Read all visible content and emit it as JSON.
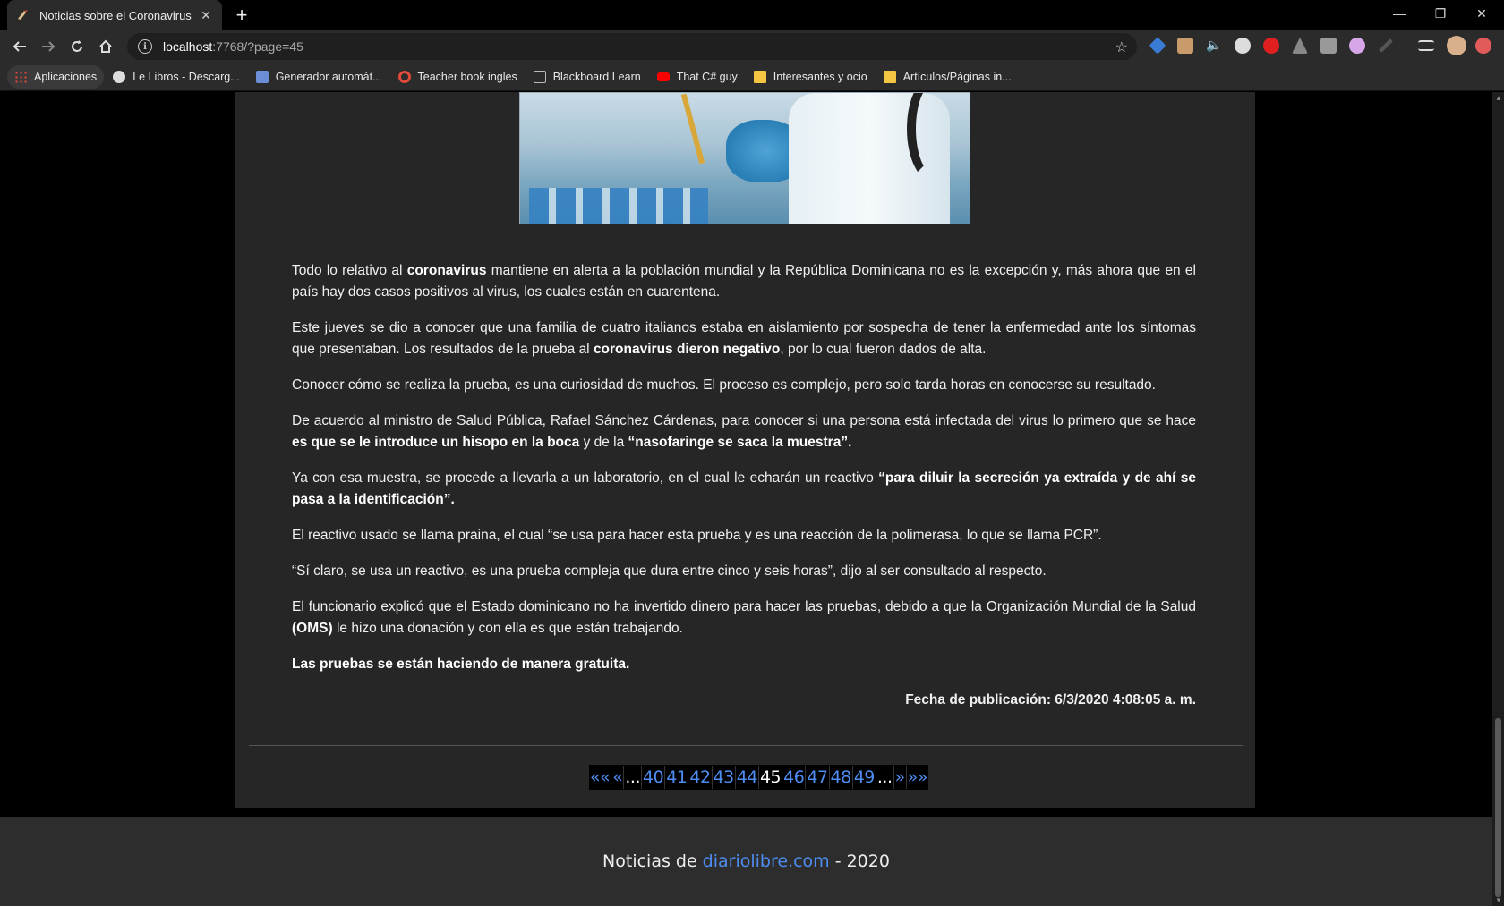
{
  "tab": {
    "title": "Noticias sobre el Coronavirus"
  },
  "address": {
    "host": "localhost",
    "rest": ":7768/?page=45"
  },
  "bookmarks": [
    {
      "label": "Aplicaciones",
      "color": "#e8453c"
    },
    {
      "label": "Le Libros - Descarg...",
      "color": "#dddddd"
    },
    {
      "label": "Generador automát...",
      "color": "#6a8fd6"
    },
    {
      "label": "Teacher book ingles",
      "color": "#e04a3a"
    },
    {
      "label": "Blackboard Learn",
      "color": "#bbbbbb"
    },
    {
      "label": "That C# guy",
      "color": "#ff0000"
    },
    {
      "label": "Interesantes y ocio",
      "color": "#f4c542"
    },
    {
      "label": "Artículos/Páginas in...",
      "color": "#f4c542"
    }
  ],
  "article": {
    "p1": {
      "a": "Todo lo relativo al ",
      "b": "coronavirus",
      "c": " mantiene en alerta a la población mundial y la República Dominicana no es la excepción y, más ahora que en el país hay dos casos positivos al virus, los cuales están en cuarentena."
    },
    "p2": {
      "a": "Este jueves se dio a conocer que una familia de cuatro italianos estaba en aislamiento por sospecha de tener la enfermedad ante los síntomas que presentaban. Los resultados de la prueba al ",
      "b": "coronavirus dieron negativo",
      "c": ", por lo cual fueron dados de alta."
    },
    "p3": "Conocer cómo se realiza la prueba, es una curiosidad de muchos. El proceso es complejo, pero solo tarda horas en conocerse su resultado.",
    "p4": {
      "a": "De acuerdo al ministro de Salud Pública, Rafael Sánchez Cárdenas, para conocer si una persona está infectada del virus lo primero que se hace ",
      "b": "es que se le introduce un hisopo en la boca",
      "c": " y de la ",
      "d": "“nasofaringe se saca la muestra”."
    },
    "p5": {
      "a": "Ya con esa muestra, se procede a llevarla a un laboratorio, en el cual le echarán un reactivo ",
      "b": "“para diluir la secreción ya extraída y de ahí se pasa a la identificación”."
    },
    "p6": "El reactivo usado se llama praina, el cual “se usa para hacer esta prueba y es una reacción de la polimerasa, lo que se llama PCR”.",
    "p7": "“Sí claro, se usa un reactivo, es una prueba compleja que dura entre cinco y seis horas”, dijo al ser consultado al respecto.",
    "p8": {
      "a": "El funcionario explicó que el Estado dominicano no ha invertido dinero para hacer las pruebas, debido a que la Organización Mundial de la Salud ",
      "b": "(OMS)",
      "c": " le hizo una donación y con ella es que están trabajando."
    },
    "p9": "Las pruebas se están haciendo de manera gratuita.",
    "pubdate": "Fecha de publicación: 6/3/2020 4:08:05 a. m."
  },
  "pager": {
    "first": "««",
    "prev": "«",
    "ellipsis_left": "...",
    "pages_before": [
      "40",
      "41",
      "42",
      "43",
      "44"
    ],
    "current": "45",
    "pages_after": [
      "46",
      "47",
      "48",
      "49"
    ],
    "ellipsis_right": "...",
    "next": "»",
    "last": "»»"
  },
  "footer": {
    "prefix": "Noticias de",
    "link": "diariolibre.com",
    "suffix": "- 2020"
  },
  "colors": {
    "link": "#4d8cf0",
    "panel": "#262626",
    "footer": "#2d2d2d"
  }
}
